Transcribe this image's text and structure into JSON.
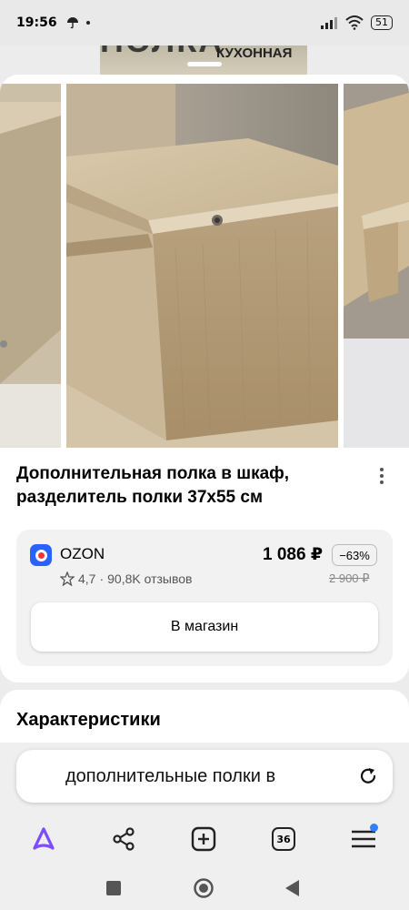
{
  "status_bar": {
    "time": "19:56",
    "battery": "51",
    "icons": [
      "umbrella-icon",
      "notification-dot-icon",
      "signal-icon",
      "wifi-icon",
      "battery-icon"
    ]
  },
  "background_banner": {
    "big_text": "ПОЛКА",
    "sub_text": "КУХОННАЯ"
  },
  "product": {
    "title": "Дополнительная полка в шкаф, разделитель полки 37x55 см",
    "images": [
      "shelf-photo-left",
      "shelf-photo-center",
      "shelf-photo-right"
    ]
  },
  "offer": {
    "shop_name": "OZON",
    "rating": "4,7",
    "reviews": "90,8K отзывов",
    "rating_separator": "·",
    "price": "1 086 ₽",
    "discount": "−63%",
    "old_price": "2 900 ₽",
    "button_label": "В магазин",
    "colors": {
      "ozon_blue": "#2962ff",
      "ozon_red": "#ff3333"
    }
  },
  "characteristics": {
    "title": "Характеристики"
  },
  "search": {
    "query": "дополнительные полки в"
  },
  "tabbar": {
    "tabs_count": "36",
    "items": [
      "alice-icon",
      "share-icon",
      "new-tab-icon",
      "tabs-icon",
      "menu-icon"
    ],
    "colors": {
      "alice": "#7b4dff",
      "notification": "#2f80ff"
    }
  },
  "navbar": {
    "items": [
      "recent-apps-icon",
      "home-icon",
      "back-icon"
    ]
  }
}
